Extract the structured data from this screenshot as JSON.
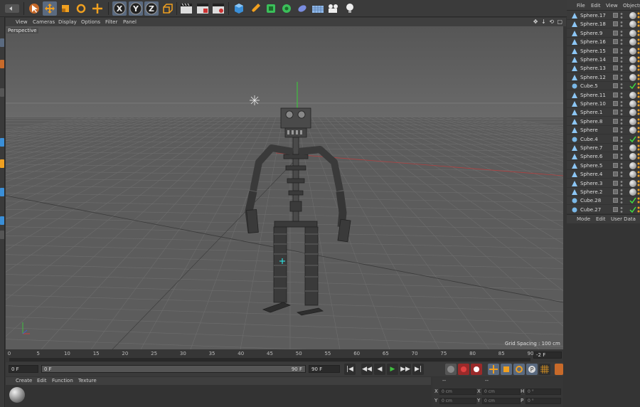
{
  "toolbar": {
    "icons": [
      "undo-icon",
      "select-arrow-icon",
      "move-icon",
      "scale-icon",
      "rotate-icon",
      "move-alt-icon",
      "x-axis-icon",
      "y-axis-icon",
      "z-axis-icon",
      "world-coordinates-icon",
      "render-view-icon",
      "render-picture-viewer-icon",
      "render-settings-icon",
      "cube-icon",
      "pen-icon",
      "subdivision-icon",
      "array-icon",
      "deformer-icon",
      "floor-icon",
      "camera-icon",
      "light-icon"
    ],
    "axis_labels": [
      "X",
      "Y",
      "Z"
    ]
  },
  "viewport": {
    "menu": [
      "View",
      "Cameras",
      "Display",
      "Options",
      "Filter",
      "Panel"
    ],
    "nav_icons": "✥ ↓ ⟲ ▢",
    "label": "Perspective",
    "grid_spacing": "Grid Spacing : 100 cm",
    "background_color": "#5f5f5f"
  },
  "timeline": {
    "ticks": [
      "0",
      "5",
      "10",
      "15",
      "20",
      "25",
      "30",
      "35",
      "40",
      "45",
      "50",
      "55",
      "60",
      "65",
      "70",
      "75",
      "80",
      "85",
      "90"
    ],
    "current_frame_field": "-2 F"
  },
  "transport": {
    "start_field": "0 F",
    "range_start": "0 F",
    "range_end": "90 F",
    "end_field": "90 F",
    "buttons": [
      "|◀",
      "◀◀",
      "◀",
      "▶",
      "▶▶",
      "▶|"
    ]
  },
  "material_manager": {
    "menu": [
      "Create",
      "Edit",
      "Function",
      "Texture"
    ]
  },
  "coordinates": {
    "header": [
      "--",
      "--"
    ],
    "rows": [
      {
        "axis": "X",
        "value": "0 cm",
        "axis2": "X",
        "value2": "0 cm",
        "axis3": "H",
        "value3": "0 °"
      },
      {
        "axis": "Y",
        "value": "0 cm",
        "axis2": "Y",
        "value2": "0 cm",
        "axis3": "P",
        "value3": "0 °"
      }
    ]
  },
  "object_manager": {
    "menu": [
      "File",
      "Edit",
      "View",
      "Objects"
    ],
    "objects": [
      {
        "name": "Sphere.17",
        "type": "sphere"
      },
      {
        "name": "Sphere.18",
        "type": "sphere"
      },
      {
        "name": "Sphere.9",
        "type": "sphere"
      },
      {
        "name": "Sphere.16",
        "type": "sphere"
      },
      {
        "name": "Sphere.15",
        "type": "sphere"
      },
      {
        "name": "Sphere.14",
        "type": "sphere"
      },
      {
        "name": "Sphere.13",
        "type": "sphere"
      },
      {
        "name": "Sphere.12",
        "type": "sphere"
      },
      {
        "name": "Cube.5",
        "type": "cube"
      },
      {
        "name": "Sphere.11",
        "type": "sphere"
      },
      {
        "name": "Sphere.10",
        "type": "sphere"
      },
      {
        "name": "Sphere.1",
        "type": "sphere"
      },
      {
        "name": "Sphere.8",
        "type": "sphere"
      },
      {
        "name": "Sphere",
        "type": "sphere"
      },
      {
        "name": "Cube.4",
        "type": "cube"
      },
      {
        "name": "Sphere.7",
        "type": "sphere"
      },
      {
        "name": "Sphere.6",
        "type": "sphere"
      },
      {
        "name": "Sphere.5",
        "type": "sphere"
      },
      {
        "name": "Sphere.4",
        "type": "sphere"
      },
      {
        "name": "Sphere.3",
        "type": "sphere"
      },
      {
        "name": "Sphere.2",
        "type": "sphere"
      },
      {
        "name": "Cube.28",
        "type": "cube"
      },
      {
        "name": "Cube.27",
        "type": "cube"
      }
    ]
  },
  "attribute_manager": {
    "menu": [
      "Mode",
      "Edit",
      "User Data"
    ]
  }
}
